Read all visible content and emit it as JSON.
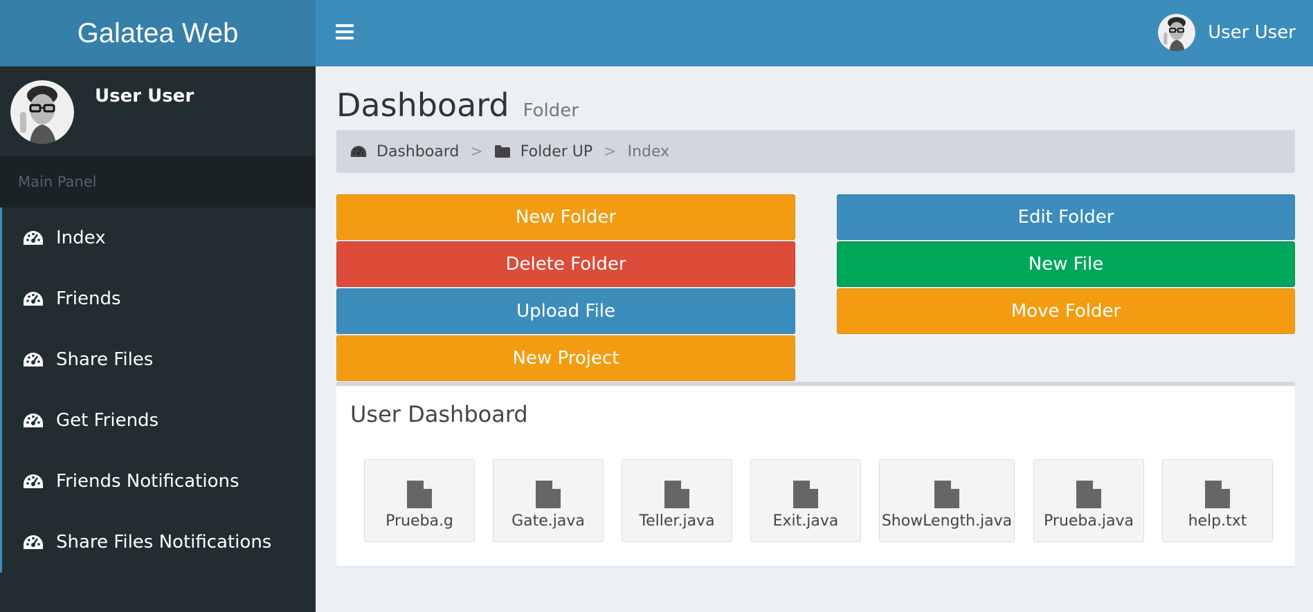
{
  "app": {
    "title": "Galatea Web"
  },
  "navbar": {
    "menu_icon": "hamburger-icon",
    "user_name": "User User"
  },
  "sidebar": {
    "user_name": "User User",
    "section_header": "Main Panel",
    "items": [
      {
        "label": "Index",
        "icon": "dashboard-icon"
      },
      {
        "label": "Friends",
        "icon": "dashboard-icon"
      },
      {
        "label": "Share Files",
        "icon": "dashboard-icon"
      },
      {
        "label": "Get Friends",
        "icon": "dashboard-icon"
      },
      {
        "label": "Friends Notifications",
        "icon": "dashboard-icon"
      },
      {
        "label": "Share Files Notifications",
        "icon": "dashboard-icon"
      }
    ]
  },
  "page": {
    "title": "Dashboard",
    "subtitle": "Folder"
  },
  "breadcrumb": {
    "items": [
      "Dashboard",
      "Folder UP",
      "Index"
    ],
    "separator": ">"
  },
  "actions": {
    "new_folder": "New Folder",
    "delete_folder": "Delete Folder",
    "upload_file": "Upload File",
    "new_project": "New Project",
    "edit_folder": "Edit Folder",
    "new_file": "New File",
    "move_folder": "Move Folder"
  },
  "box": {
    "title": "User Dashboard",
    "files": [
      "Prueba.g",
      "Gate.java",
      "Teller.java",
      "Exit.java",
      "ShowLength.java",
      "Prueba.java",
      "help.txt"
    ]
  },
  "colors": {
    "header_dark": "#367fa9",
    "header": "#3c8dbc",
    "sidebar": "#222d32",
    "warning": "#f39c12",
    "danger": "#dd4b39",
    "success": "#00a65a"
  }
}
